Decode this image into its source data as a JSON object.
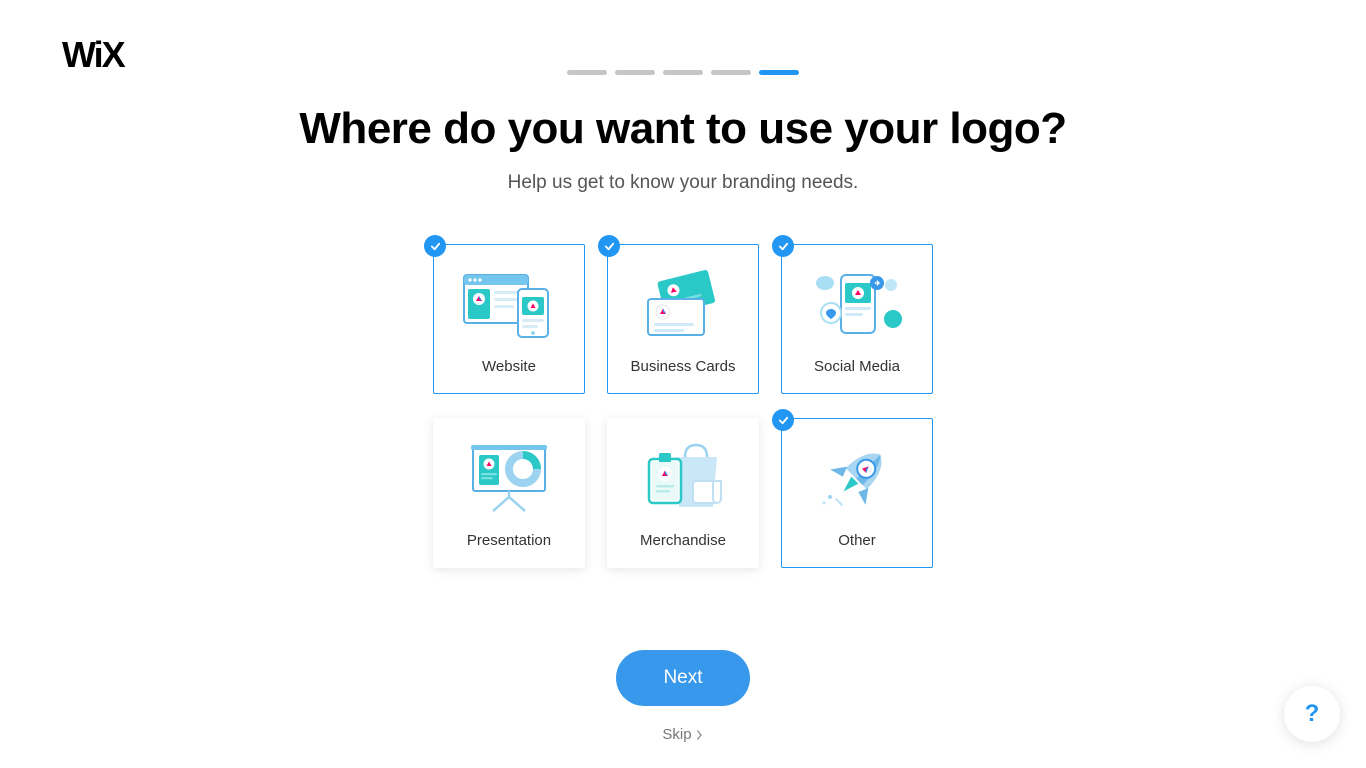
{
  "brand": "WiX",
  "progress": {
    "total": 5,
    "current": 5
  },
  "heading": "Where do you want to use your logo?",
  "subheading": "Help us get to know your branding needs.",
  "options": [
    {
      "id": "website",
      "label": "Website",
      "selected": true
    },
    {
      "id": "business-cards",
      "label": "Business Cards",
      "selected": true
    },
    {
      "id": "social-media",
      "label": "Social Media",
      "selected": true
    },
    {
      "id": "presentation",
      "label": "Presentation",
      "selected": false
    },
    {
      "id": "merchandise",
      "label": "Merchandise",
      "selected": false
    },
    {
      "id": "other",
      "label": "Other",
      "selected": true
    }
  ],
  "actions": {
    "next": "Next",
    "skip": "Skip",
    "help": "?"
  },
  "colors": {
    "accent": "#2196f3",
    "button": "#3899ec",
    "teal": "#2bc8c8",
    "illus_light": "#a8d8f0",
    "illus_mid": "#6eb8e8"
  }
}
